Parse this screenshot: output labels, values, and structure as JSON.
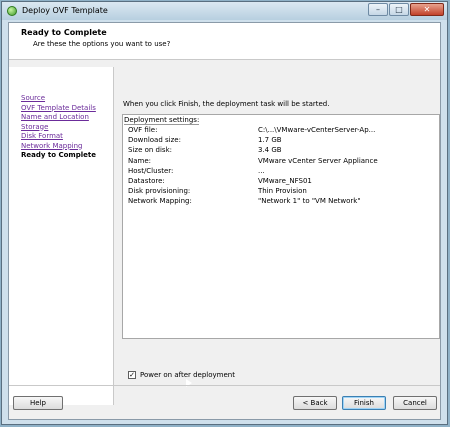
{
  "window": {
    "title": "Deploy OVF Template"
  },
  "header": {
    "title": "Ready to Complete",
    "subtitle": "Are these the options you want to use?"
  },
  "nav": {
    "items": [
      {
        "label": "Source",
        "current": false
      },
      {
        "label": "OVF Template Details",
        "current": false
      },
      {
        "label": "Name and Location",
        "current": false
      },
      {
        "label": "Storage",
        "current": false
      },
      {
        "label": "Disk Format",
        "current": false
      },
      {
        "label": "Network Mapping",
        "current": false
      },
      {
        "label": "Ready to Complete",
        "current": true
      }
    ]
  },
  "main": {
    "intro": "When you click Finish, the deployment task will be started.",
    "settings_heading": "Deployment settings:",
    "settings": [
      {
        "key": "OVF file:",
        "value": "C:\\...\\VMware-vCenterServer-Ap..."
      },
      {
        "key": "Download size:",
        "value": "1.7 GB"
      },
      {
        "key": "Size on disk:",
        "value": "3.4 GB"
      },
      {
        "key": "Name:",
        "value": "VMware vCenter Server Appliance"
      },
      {
        "key": "Host/Cluster:",
        "value": "..."
      },
      {
        "key": "Datastore:",
        "value": "VMware_NFS01"
      },
      {
        "key": "Disk provisioning:",
        "value": "Thin Provision"
      },
      {
        "key": "Network Mapping:",
        "value": "\"Network 1\" to \"VM Network\""
      }
    ],
    "power_on_label": "Power on after deployment",
    "power_on_checked": true
  },
  "footer": {
    "help": "Help",
    "back": "< Back",
    "finish": "Finish",
    "cancel": "Cancel"
  }
}
